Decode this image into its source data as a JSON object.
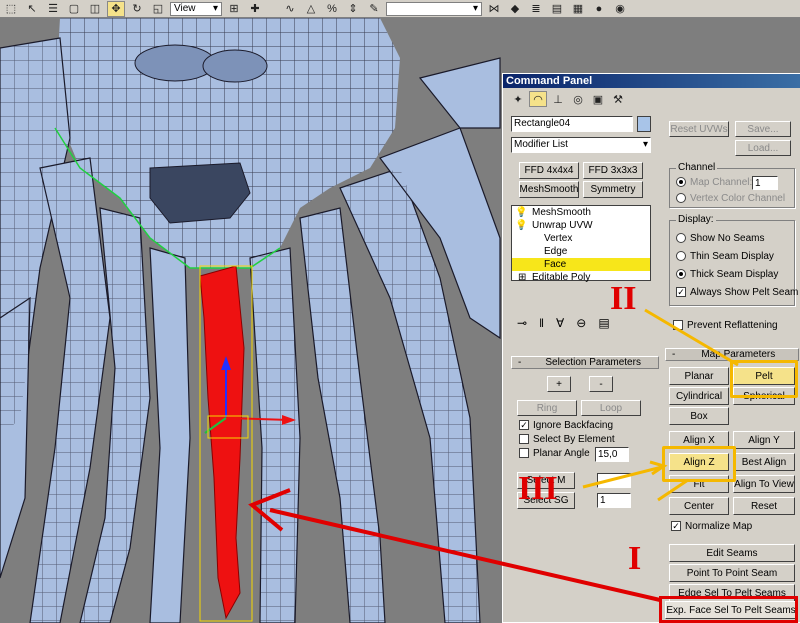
{
  "toolbar": {
    "view_dropdown": "View",
    "icons": [
      "select-region-icon",
      "select-arrow-icon",
      "select-by-name-icon",
      "select-rect-icon",
      "window-crossing-icon",
      "move-icon",
      "rotate-icon",
      "scale-icon",
      "snap-icon",
      "angle-snap-icon",
      "percent-snap-icon",
      "spinner-snap-icon",
      "mirror-icon",
      "align-icon",
      "layers-icon",
      "curve-editor-icon",
      "schematic-icon",
      "material-editor-icon",
      "render-icon"
    ]
  },
  "panel": {
    "title": "Command Panel",
    "object_name": "Rectangle04",
    "modifier_list": "Modifier List",
    "mod_buttons": [
      "FFD 4x4x4",
      "FFD 3x3x3",
      "MeshSmooth",
      "Symmetry"
    ],
    "stack": [
      {
        "label": "MeshSmooth",
        "level": 0,
        "selected": false
      },
      {
        "label": "Unwrap UVW",
        "level": 0,
        "selected": false
      },
      {
        "label": "Vertex",
        "level": 1,
        "selected": false
      },
      {
        "label": "Edge",
        "level": 1,
        "selected": false
      },
      {
        "label": "Face",
        "level": 1,
        "selected": true
      },
      {
        "label": "Editable Poly",
        "level": 0,
        "selected": false
      }
    ],
    "selection": {
      "rollout": "Selection Parameters",
      "plus": "+",
      "minus": "-",
      "ring": "Ring",
      "loop": "Loop",
      "ignore_backfacing": "Ignore Backfacing",
      "select_by_element": "Select By Element",
      "planar_angle": "Planar Angle",
      "planar_value": "15,0",
      "select_sg": "Select SG",
      "select_matid_partial": "Select M",
      "spin_value_1": "",
      "spin_value_2": "1"
    },
    "right": {
      "reset_uvws": "Reset UVWs",
      "save": "Save...",
      "load": "Load...",
      "channel_group": "Channel",
      "map_channel": "Map Channel:",
      "map_channel_value": "1",
      "vertex_color_channel": "Vertex Color Channel",
      "display_group": "Display:",
      "show_no_seams": "Show No Seams",
      "thin_seam": "Thin Seam Display",
      "thick_seam": "Thick Seam Display",
      "always_show_pelt": "Always Show Pelt Seam",
      "prevent_reflattening": "Prevent Reflattening",
      "map_params_rollout": "Map Parameters",
      "planar": "Planar",
      "pelt": "Pelt",
      "cylindrical": "Cylindrical",
      "spherical": "Spherical",
      "box": "Box",
      "align_x": "Align X",
      "align_y": "Align Y",
      "align_z": "Align Z",
      "best_align": "Best Align",
      "fit": "Fit",
      "align_to_view": "Align To View",
      "center": "Center",
      "reset": "Reset",
      "normalize_map": "Normalize Map",
      "edit_seams": "Edit Seams",
      "point_to_point": "Point To Point Seam",
      "edge_sel_to_pelt": "Edge Sel To Pelt Seams",
      "exp_face_sel": "Exp. Face Sel To Pelt Seams"
    }
  },
  "annotations": {
    "label_I": "I",
    "label_II": "II",
    "label_III": "III"
  },
  "colors": {
    "annotation_red": "#e00000",
    "annotation_yellow": "#f5b800",
    "selected_face": "#ee1111",
    "mesh_fill": "#a9bee0",
    "mesh_line": "#1a1a2a"
  }
}
